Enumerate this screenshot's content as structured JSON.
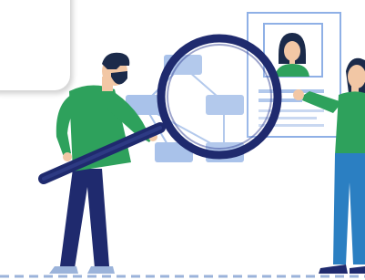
{
  "scene": {
    "description_icon": "recruitment-search-illustration",
    "colors": {
      "navy": "#1f2a6e",
      "green": "#2ea15c",
      "blue_node": "#a9c2ea",
      "profile_frame": "#8fb0e6",
      "skin": "#f2c7a5",
      "hair": "#1b2a4a",
      "woman_pants": "#2b7fc2",
      "ground_line": "#9bb3da"
    }
  }
}
